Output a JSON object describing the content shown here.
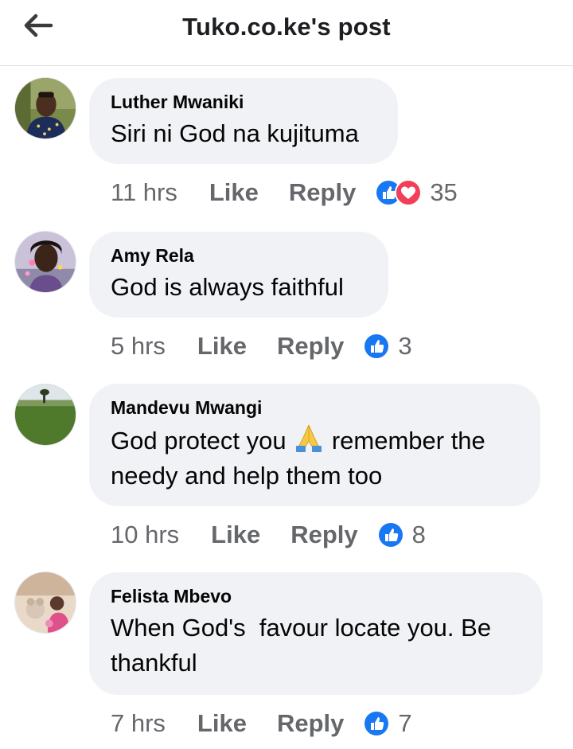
{
  "header": {
    "title": "Tuko.co.ke's post",
    "back_icon": "arrow-left-icon"
  },
  "colors": {
    "bubble": "#f0f2f5",
    "meta_text": "#65676b",
    "like_blue": "#1877f2",
    "love_red": "#f33e58",
    "divider": "#dadde1"
  },
  "comments": [
    {
      "author": "Luther Mwaniki",
      "text": "Siri ni God na kujituma",
      "time": "11 hrs",
      "like_label": "Like",
      "reply_label": "Reply",
      "reactions": [
        "like",
        "love"
      ],
      "reaction_count": "35"
    },
    {
      "author": "Amy Rela",
      "text": "God is always faithful",
      "time": "5 hrs",
      "like_label": "Like",
      "reply_label": "Reply",
      "reactions": [
        "like"
      ],
      "reaction_count": "3"
    },
    {
      "author": "Mandevu Mwangi",
      "text_part1": "God protect you",
      "emoji": "folded-hands-icon",
      "text_part2": "remember the needy and help them too",
      "time": "10 hrs",
      "like_label": "Like",
      "reply_label": "Reply",
      "reactions": [
        "like"
      ],
      "reaction_count": "8"
    },
    {
      "author": "Felista Mbevo",
      "text": "When God's  favour locate you. Be thankful",
      "time": "7 hrs",
      "like_label": "Like",
      "reply_label": "Reply",
      "reactions": [
        "like"
      ],
      "reaction_count": "7"
    }
  ]
}
